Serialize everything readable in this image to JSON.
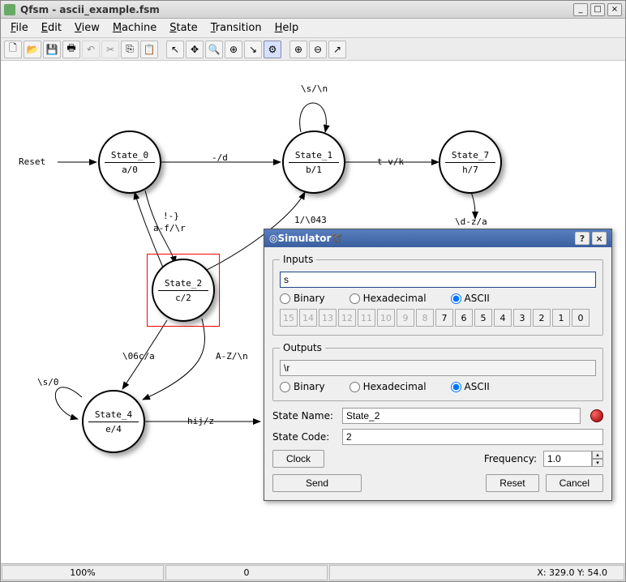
{
  "window": {
    "title": "Qfsm - ascii_example.fsm"
  },
  "menu": {
    "file": "File",
    "edit": "Edit",
    "view": "View",
    "machine": "Machine",
    "state": "State",
    "transition": "Transition",
    "help": "Help"
  },
  "toolbar_icons": [
    "new",
    "open",
    "save",
    "print",
    "undo",
    "cut",
    "copy",
    "paste",
    "select",
    "pan",
    "zoom",
    "newstate",
    "newtrans",
    "simulate",
    "zoomin",
    "zoomout",
    "arrow"
  ],
  "states": {
    "s0": {
      "name": "State_0",
      "out": "a/0"
    },
    "s1": {
      "name": "State_1",
      "out": "b/1"
    },
    "s2": {
      "name": "State_2",
      "out": "c/2"
    },
    "s4": {
      "name": "State_4",
      "out": "e/4"
    },
    "s7": {
      "name": "State_7",
      "out": "h/7"
    }
  },
  "transitions": {
    "reset": "Reset",
    "t01": "-/d",
    "t11": "\\s/\\n",
    "t17": "t-v/k",
    "t02a": "!-}",
    "t02b": "a-f/\\r",
    "t21": "1/\\043",
    "t7x": "\\d-z/a",
    "s40": "\\s/0",
    "t24a": "\\06c/a",
    "t24b": "A-Z/\\n",
    "t4x": "hij/z"
  },
  "status": {
    "zoom": "100%",
    "sel": "0",
    "coords": "X: 329.0 Y: 54.0"
  },
  "simulator": {
    "title": "Simulator",
    "inputs_legend": "Inputs",
    "outputs_legend": "Outputs",
    "input_value": "s",
    "output_value": "\\r",
    "fmt_binary": "Binary",
    "fmt_hex": "Hexadecimal",
    "fmt_ascii": "ASCII",
    "bits": [
      "15",
      "14",
      "13",
      "12",
      "11",
      "10",
      "9",
      "8",
      "7",
      "6",
      "5",
      "4",
      "3",
      "2",
      "1",
      "0"
    ],
    "state_name_label": "State Name:",
    "state_name": "State_2",
    "state_code_label": "State Code:",
    "state_code": "2",
    "clock": "Clock",
    "freq_label": "Frequency:",
    "freq": "1.0",
    "send": "Send",
    "reset": "Reset",
    "cancel": "Cancel"
  }
}
